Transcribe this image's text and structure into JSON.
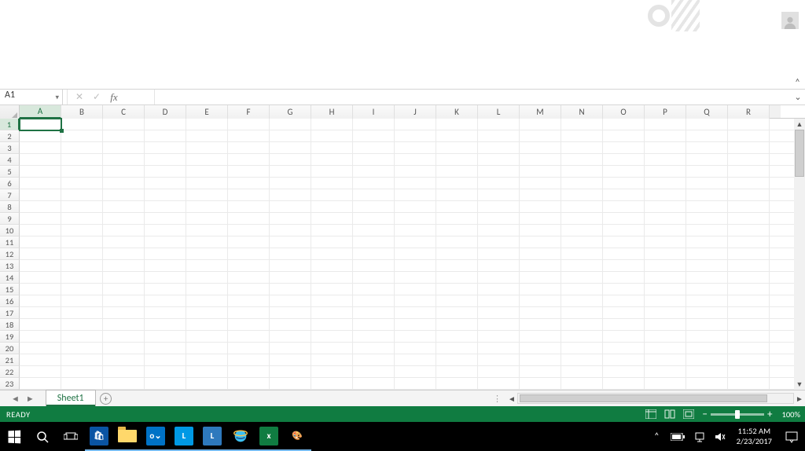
{
  "namebox": {
    "value": "A1"
  },
  "formula_bar": {
    "cancel_glyph": "✕",
    "accept_glyph": "✓",
    "fx_label": "fx",
    "value": ""
  },
  "ribbon": {
    "collapse_glyph": "˄"
  },
  "columns": [
    "A",
    "B",
    "C",
    "D",
    "E",
    "F",
    "G",
    "H",
    "I",
    "J",
    "K",
    "L",
    "M",
    "N",
    "O",
    "P",
    "Q",
    "R"
  ],
  "rows": [
    "1",
    "2",
    "3",
    "4",
    "5",
    "6",
    "7",
    "8",
    "9",
    "10",
    "11",
    "12",
    "13",
    "14",
    "15",
    "16",
    "17",
    "18",
    "19",
    "20",
    "21",
    "22",
    "23"
  ],
  "active_col_index": 0,
  "active_row_index": 0,
  "sheet_tabs": {
    "nav_prev": "◄",
    "nav_next": "►",
    "active": "Sheet1",
    "new_glyph": "+"
  },
  "hscroll": {
    "left": "◄",
    "right": "►"
  },
  "vscroll": {
    "up": "▲",
    "down": "▼"
  },
  "status": {
    "ready": "READY",
    "zoom_minus": "−",
    "zoom_plus": "+",
    "zoom_pct": "100%"
  },
  "taskbar": {
    "apps": {
      "store": "⊞",
      "outlook": "o⌄",
      "mgr": "L",
      "lync": "L",
      "excel": "x"
    }
  },
  "tray": {
    "caret": "˄",
    "time": "11:52 AM",
    "date": "2/23/2017"
  }
}
